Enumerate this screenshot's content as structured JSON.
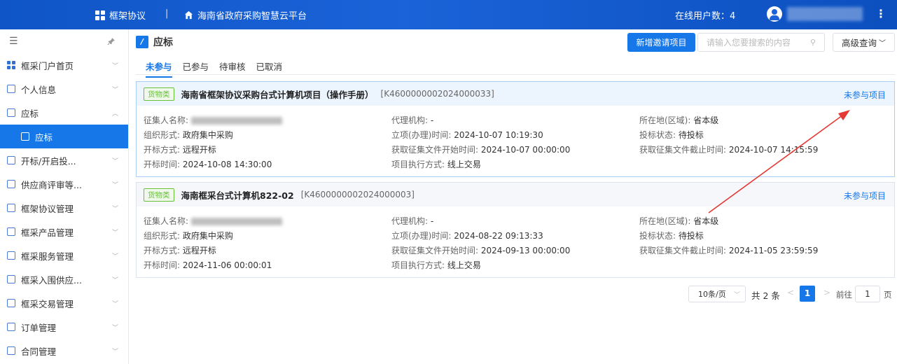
{
  "topbar": {
    "app_label": "框架协议",
    "separator": "|",
    "platform_label": "海南省政府采购智慧云平台",
    "online_label": "在线用户数：4"
  },
  "sidebar": {
    "items": [
      {
        "label": "框采门户首页"
      },
      {
        "label": "个人信息"
      },
      {
        "label": "应标"
      },
      {
        "label": "应标"
      },
      {
        "label": "开标/开启投..."
      },
      {
        "label": "供应商评审等..."
      },
      {
        "label": "框架协议管理"
      },
      {
        "label": "框采产品管理"
      },
      {
        "label": "框采服务管理"
      },
      {
        "label": "框采入围供应..."
      },
      {
        "label": "框采交易管理"
      },
      {
        "label": "订单管理"
      },
      {
        "label": "合同管理"
      }
    ]
  },
  "page": {
    "title": "应标",
    "new_button": "新增邀请项目",
    "search_placeholder": "请输入您要搜索的内容",
    "advanced_button": "高级查询",
    "tabs": [
      "未参与",
      "已参与",
      "待审核",
      "已取消"
    ]
  },
  "cards": [
    {
      "tag": "货物类",
      "title": "海南省框架协议采购台式计算机项目（操作手册）",
      "code": "[K4600000002024000033]",
      "link": "未参与项目",
      "fields": {
        "collector_label": "征集人名称:",
        "org_form_label": "组织形式:",
        "org_form": "政府集中采购",
        "open_mode_label": "开标方式:",
        "open_mode": "远程开标",
        "open_time_label": "开标时间:",
        "open_time": "2024-10-08 14:30:00",
        "agency_label": "代理机构:",
        "agency": "-",
        "setup_label": "立项(办理)时间:",
        "setup": "2024-10-07 10:19:30",
        "file_start_label": "获取征集文件开始时间:",
        "file_start": "2024-10-07 00:00:00",
        "exec_label": "项目执行方式:",
        "exec": "线上交易",
        "region_label": "所在地(区域):",
        "region": "省本级",
        "bid_status_label": "投标状态:",
        "bid_status": "待投标",
        "file_end_label": "获取征集文件截止时间:",
        "file_end": "2024-10-07 14:15:59"
      }
    },
    {
      "tag": "货物类",
      "title": "海南框采台式计算机822-02",
      "code": "[K4600000002024000003]",
      "link": "未参与项目",
      "fields": {
        "collector_label": "征集人名称:",
        "org_form_label": "组织形式:",
        "org_form": "政府集中采购",
        "open_mode_label": "开标方式:",
        "open_mode": "远程开标",
        "open_time_label": "开标时间:",
        "open_time": "2024-11-06 00:00:01",
        "agency_label": "代理机构:",
        "agency": "-",
        "setup_label": "立项(办理)时间:",
        "setup": "2024-08-22 09:13:33",
        "file_start_label": "获取征集文件开始时间:",
        "file_start": "2024-09-13 00:00:00",
        "exec_label": "项目执行方式:",
        "exec": "线上交易",
        "region_label": "所在地(区域):",
        "region": "省本级",
        "bid_status_label": "投标状态:",
        "bid_status": "待投标",
        "file_end_label": "获取征集文件截止时间:",
        "file_end": "2024-11-05 23:59:59"
      }
    }
  ],
  "pagination": {
    "page_size": "10条/页",
    "total": "共 2 条",
    "current": "1",
    "goto_label": "前往",
    "goto_value": "1",
    "page_suffix": "页"
  },
  "colors": {
    "primary": "#1677e8",
    "topbar": "#1a63d8",
    "annotation": "#e53935",
    "tag": "#67c23a"
  }
}
